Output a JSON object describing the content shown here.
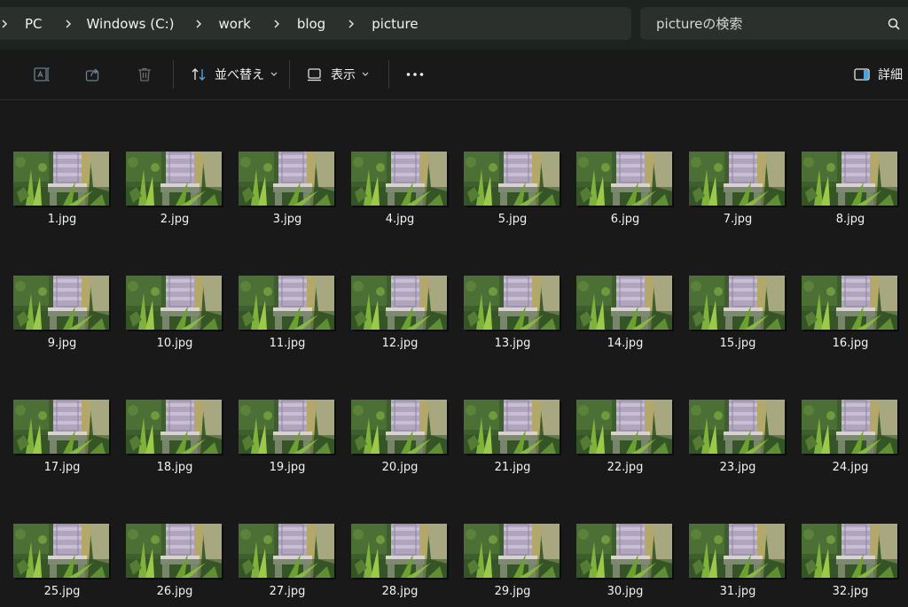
{
  "breadcrumb": [
    "PC",
    "Windows (C:)",
    "work",
    "blog",
    "picture"
  ],
  "search": {
    "placeholder": "pictureの検索"
  },
  "toolbar": {
    "sort_label": "並べ替え",
    "view_label": "表示",
    "details_label": "詳細"
  },
  "icons": {
    "rename": "rename-icon",
    "share": "share-icon",
    "delete": "trash-icon",
    "sort": "sort-icon",
    "view": "view-icon",
    "more": "more-icon",
    "details": "details-pane-icon",
    "search": "search-icon"
  },
  "files": [
    "1.jpg",
    "2.jpg",
    "3.jpg",
    "4.jpg",
    "5.jpg",
    "6.jpg",
    "7.jpg",
    "8.jpg",
    "9.jpg",
    "10.jpg",
    "11.jpg",
    "12.jpg",
    "13.jpg",
    "14.jpg",
    "15.jpg",
    "16.jpg",
    "17.jpg",
    "18.jpg",
    "19.jpg",
    "20.jpg",
    "21.jpg",
    "22.jpg",
    "23.jpg",
    "24.jpg",
    "25.jpg",
    "26.jpg",
    "27.jpg",
    "28.jpg",
    "29.jpg",
    "30.jpg",
    "31.jpg",
    "32.jpg"
  ],
  "colors": {
    "background": "#191919",
    "address_bar": "#1d2420",
    "accent_blue": "#4aa3e0"
  }
}
